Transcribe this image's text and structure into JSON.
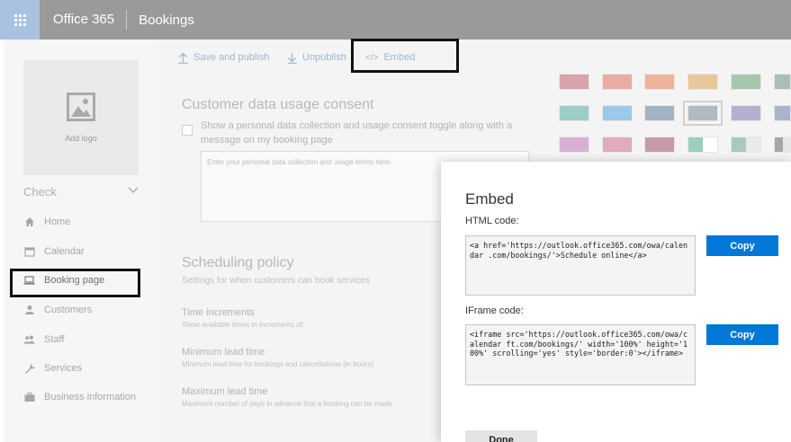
{
  "header": {
    "brand": "Office 365",
    "app": "Bookings"
  },
  "toolbar": {
    "save_label": "Save and publish",
    "unpublish_label": "Unpublish",
    "embed_label": "Embed"
  },
  "sidebar": {
    "add_logo_label": "Add logo",
    "business_name": "Check",
    "items": [
      {
        "label": "Home",
        "icon": "home-icon"
      },
      {
        "label": "Calendar",
        "icon": "calendar-icon"
      },
      {
        "label": "Booking page",
        "icon": "laptop-icon",
        "selected": true
      },
      {
        "label": "Customers",
        "icon": "person-icon"
      },
      {
        "label": "Staff",
        "icon": "people-icon"
      },
      {
        "label": "Services",
        "icon": "wrench-icon"
      },
      {
        "label": "Business information",
        "icon": "briefcase-icon"
      }
    ]
  },
  "main": {
    "consent": {
      "title": "Customer data usage consent",
      "checkbox_label": "Show a personal data collection and usage consent toggle along with a message on my booking page",
      "terms_placeholder": "Enter your personal data collection and usage terms here."
    },
    "scheduling": {
      "title": "Scheduling policy",
      "subtitle": "Settings for when customers can book services",
      "time_increments": {
        "title": "Time increments",
        "desc": "Show available times in increments of:"
      },
      "min_lead": {
        "title": "Minimum lead time",
        "desc": "Minimum lead time for bookings and cancellations (in hours)"
      },
      "max_lead": {
        "title": "Maximum lead time",
        "desc": "Maximum number of days in advance that a booking can be made"
      }
    }
  },
  "theme_colors": [
    [
      "#d9a3ad",
      "#d9a3ad"
    ],
    [
      "#e8aca2",
      "#e8aca2"
    ],
    [
      "#eeb49b",
      "#eeb49b"
    ],
    [
      "#e8c89a",
      "#e8c89a"
    ],
    [
      "#a7c7ad",
      "#a7c7ad"
    ],
    [
      "#a9bfb6",
      "#a9bfb6"
    ],
    [
      "#9ccdc7",
      "#9ccdc7"
    ],
    [
      "#9cc9e7",
      "#9cc9e7"
    ],
    [
      "#a2b4c4",
      "#a2b4c4"
    ],
    [
      "#b3b9c0",
      "#b3b9c0"
    ],
    [
      "#b6afd0",
      "#b6afd0"
    ],
    [
      "#aab3c9",
      "#aab3c9"
    ],
    [
      "#d8b0d6",
      "#d8b0d6"
    ],
    [
      "#e0aac0",
      "#e0aac0"
    ],
    [
      "#c69aaa",
      "#c69aaa"
    ],
    [
      "#9dcdc1",
      "#ffffff"
    ],
    [
      "#a7c9c2",
      "#eaeaea"
    ],
    [
      "#a6a6a6",
      "#e6e6e6"
    ]
  ],
  "embed": {
    "title": "Embed",
    "html_label": "HTML code:",
    "html_code": "<a href='https://outlook.office365.com/owa/calendar                          .com/bookings/'>Schedule online</a>",
    "iframe_label": "IFrame code:",
    "iframe_code": "<iframe src='https://outlook.office365.com/owa/calendar                        ft.com/bookings/' width='100%' height='100%' scrolling='yes' style='border:0'></iframe>",
    "copy_label": "Copy",
    "done_label": "Done"
  }
}
